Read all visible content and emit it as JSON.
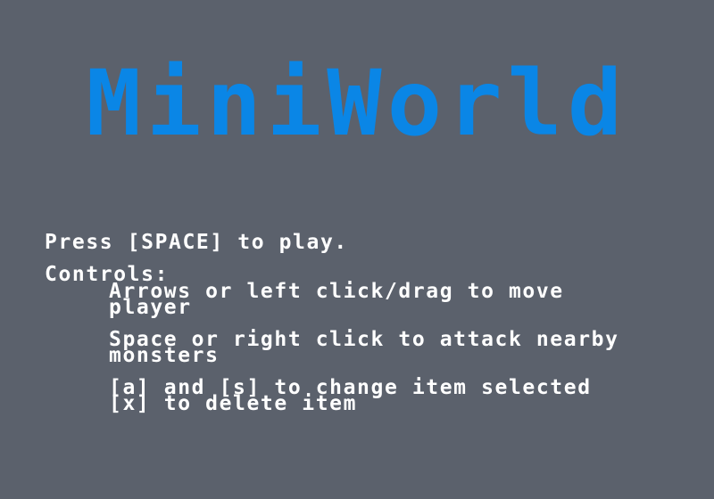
{
  "game": {
    "title": "MiniWorld",
    "start_prompt": "Press [SPACE] to play.",
    "controls_heading": "Controls:",
    "controls": [
      "Arrows or left click/drag to move",
      "player",
      "Space or right click to attack nearby",
      "monsters",
      "[a] and [s] to change item selected",
      "[x] to delete item"
    ]
  },
  "colors": {
    "background": "#5b616c",
    "title": "#0a86e6",
    "text": "#ffffff"
  }
}
